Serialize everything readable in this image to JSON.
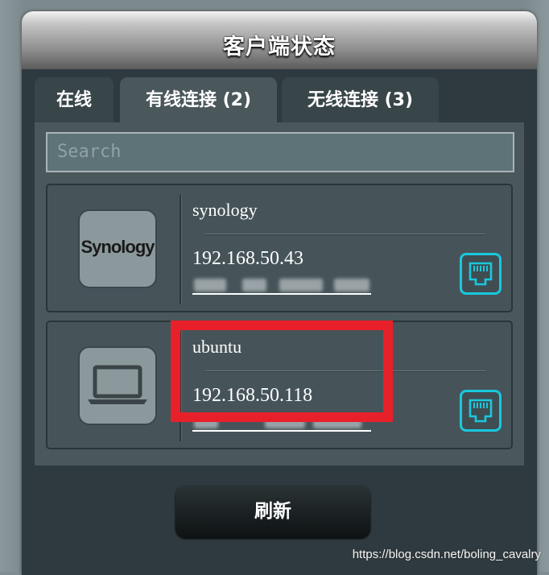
{
  "panel": {
    "title": "客户端状态"
  },
  "tabs": [
    {
      "label": "在线"
    },
    {
      "label": "有线连接 (2)"
    },
    {
      "label": "无线连接 (3)"
    }
  ],
  "search": {
    "placeholder": "Search"
  },
  "clients": [
    {
      "logo_text": "Synology",
      "name": "synology",
      "ip": "192.168.50.43"
    },
    {
      "name": "ubuntu",
      "ip": "192.168.50.118"
    }
  ],
  "refresh_label": "刷新",
  "watermark": "https://blog.csdn.net/boling_cavalry",
  "colors": {
    "accent_cyan": "#19c8dc",
    "highlight_red": "#e8202a"
  }
}
